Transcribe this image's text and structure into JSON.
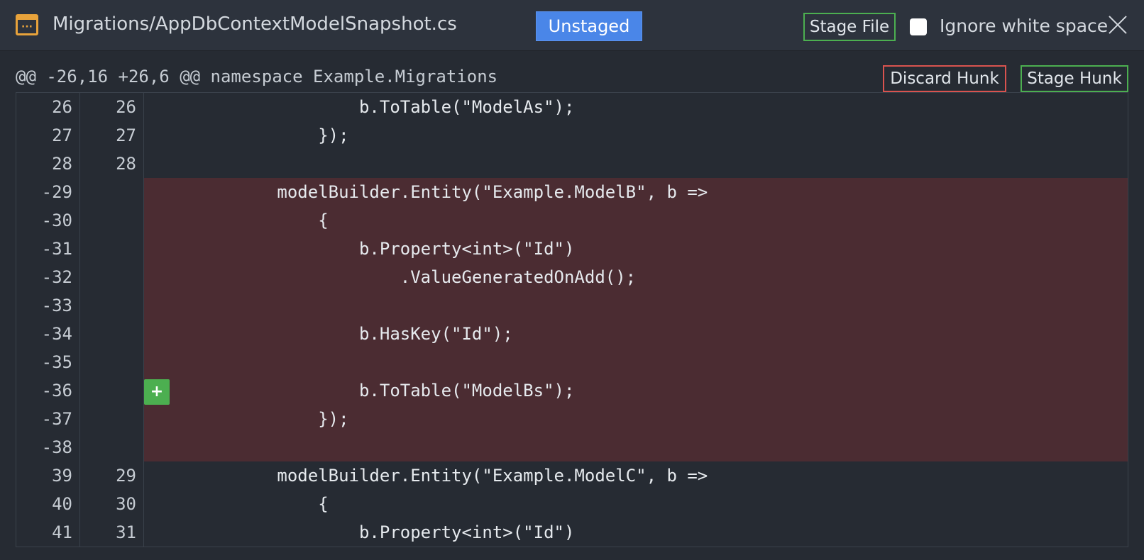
{
  "header": {
    "file_path": "Migrations/AppDbContextModelSnapshot.cs",
    "icon": "file-icon",
    "unstaged_label": "Unstaged",
    "stage_file_label": "Stage File",
    "ignore_whitespace_label": "Ignore white space",
    "ignore_whitespace_checked": false
  },
  "hunk": {
    "header": "@@ -26,16 +26,6 @@ namespace Example.Migrations",
    "discard_label": "Discard Hunk",
    "stage_label": "Stage Hunk"
  },
  "lines": [
    {
      "old": "26",
      "new": "26",
      "type": "context",
      "text": "                    b.ToTable(\"ModelAs\");"
    },
    {
      "old": "27",
      "new": "27",
      "type": "context",
      "text": "                });"
    },
    {
      "old": "28",
      "new": "28",
      "type": "context",
      "text": ""
    },
    {
      "old": "-29",
      "new": "",
      "type": "removed",
      "text": "            modelBuilder.Entity(\"Example.ModelB\", b =>"
    },
    {
      "old": "-30",
      "new": "",
      "type": "removed",
      "text": "                {"
    },
    {
      "old": "-31",
      "new": "",
      "type": "removed",
      "text": "                    b.Property<int>(\"Id\")"
    },
    {
      "old": "-32",
      "new": "",
      "type": "removed",
      "text": "                        .ValueGeneratedOnAdd();"
    },
    {
      "old": "-33",
      "new": "",
      "type": "removed",
      "text": ""
    },
    {
      "old": "-34",
      "new": "",
      "type": "removed",
      "text": "                    b.HasKey(\"Id\");"
    },
    {
      "old": "-35",
      "new": "",
      "type": "removed",
      "text": ""
    },
    {
      "old": "-36",
      "new": "",
      "type": "removed",
      "text": "                    b.ToTable(\"ModelBs\");",
      "stage_button": "+"
    },
    {
      "old": "-37",
      "new": "",
      "type": "removed",
      "text": "                });"
    },
    {
      "old": "-38",
      "new": "",
      "type": "removed",
      "text": ""
    },
    {
      "old": "39",
      "new": "29",
      "type": "context",
      "text": "            modelBuilder.Entity(\"Example.ModelC\", b =>"
    },
    {
      "old": "40",
      "new": "30",
      "type": "context",
      "text": "                {"
    },
    {
      "old": "41",
      "new": "31",
      "type": "context",
      "text": "                    b.Property<int>(\"Id\")"
    }
  ],
  "colors": {
    "background": "#262b33",
    "removed_bg": "#4b2c32",
    "accent_blue": "#4a86e8",
    "stage_green": "#4caf50",
    "discard_red": "#d9534f",
    "file_icon": "#e8a33b"
  }
}
